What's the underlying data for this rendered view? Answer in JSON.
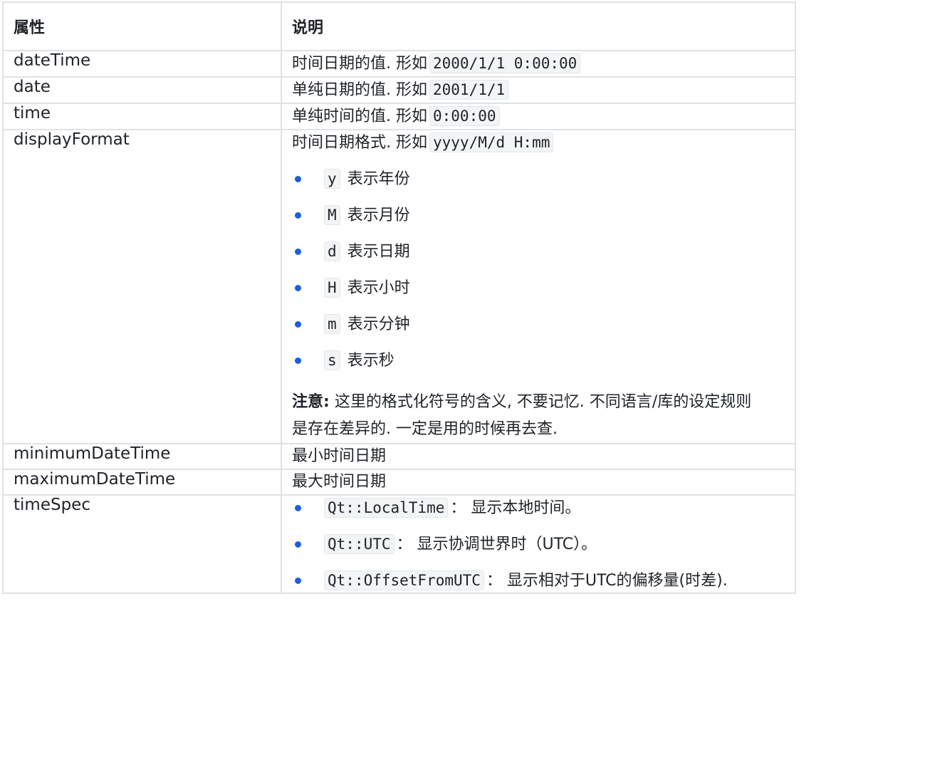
{
  "header": {
    "col1": "属性",
    "col2": "说明"
  },
  "rows": {
    "dateTime": {
      "name": "dateTime",
      "text": "时间日期的值. 形如",
      "code": "2000/1/1 0:00:00"
    },
    "date": {
      "name": "date",
      "text": "单纯日期的值. 形如",
      "code": "2001/1/1"
    },
    "time": {
      "name": "time",
      "text": "单纯时间的值. 形如",
      "code": "0:00:00"
    },
    "displayFormat": {
      "name": "displayFormat",
      "text": "时间日期格式. 形如",
      "code": "yyyy/M/d H:mm",
      "items": [
        {
          "code": "y",
          "text": "表示年份"
        },
        {
          "code": "M",
          "text": "表示月份"
        },
        {
          "code": "d",
          "text": "表示日期"
        },
        {
          "code": "H",
          "text": "表示小时"
        },
        {
          "code": "m",
          "text": "表示分钟"
        },
        {
          "code": "s",
          "text": "表示秒"
        }
      ],
      "note_label": "注意:",
      "note_line1": "这里的格式化符号的含义, 不要记忆. 不同语言/库的设定规则",
      "note_line2": "是存在差异的. 一定是用的时候再去查."
    },
    "minimumDateTime": {
      "name": "minimumDateTime",
      "text": "最小时间日期"
    },
    "maximumDateTime": {
      "name": "maximumDateTime",
      "text": "最大时间日期"
    },
    "timeSpec": {
      "name": "timeSpec",
      "items": [
        {
          "code": "Qt::LocalTime",
          "text": "： 显示本地时间。"
        },
        {
          "code": "Qt::UTC",
          "text": "： 显示协调世界时（UTC）。"
        },
        {
          "code": "Qt::OffsetFromUTC",
          "text": "： 显示相对于UTC的偏移量(时差)."
        }
      ]
    }
  },
  "colors": {
    "border": "#dfe2e5",
    "bullet": "#1a5fe0",
    "code_bg": "#f3f4f5"
  }
}
